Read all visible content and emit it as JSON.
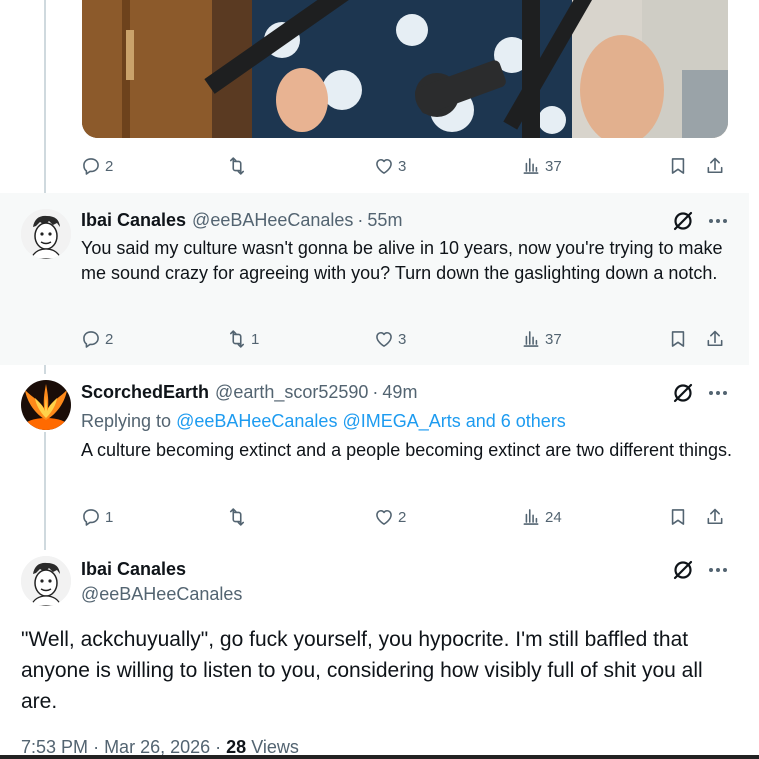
{
  "media_tweet": {
    "actions": {
      "replies": "2",
      "reposts": "",
      "likes": "3",
      "views": "37"
    }
  },
  "tweets": [
    {
      "name": "Ibai Canales",
      "handle": "@eeBAHeeCanales",
      "time": "55m",
      "text": "You said my culture wasn't gonna be alive in 10 years, now you're trying to make me sound crazy for agreeing with you? Turn down the gaslighting down a notch.",
      "actions": {
        "replies": "2",
        "reposts": "1",
        "likes": "3",
        "views": "37"
      }
    },
    {
      "name": "ScorchedEarth",
      "handle": "@earth_scor52590",
      "time": "49m",
      "replying_label": "Replying to",
      "replying_users": "@eeBAHeeCanales @IMEGA_Arts and 6 others",
      "text": "A culture becoming extinct and a people becoming extinct are two different things.",
      "actions": {
        "replies": "1",
        "reposts": "",
        "likes": "2",
        "views": "24"
      }
    }
  ],
  "focus_tweet": {
    "name": "Ibai Canales",
    "handle": "@eeBAHeeCanales",
    "text": "\"Well, ackchuyually\", go fuck yourself, you hypocrite. I'm still baffled that anyone is willing to listen to you, considering how visibly full of shit you all are.",
    "time": "7:53 PM",
    "date": "Mar 26, 2026",
    "views_count": "28",
    "views_label": "Views"
  },
  "colors": {
    "accent": "#1d9bf0",
    "muted": "#536471",
    "highlight_bg": "#f7f9f9"
  },
  "icons": [
    "reply-icon",
    "repost-icon",
    "like-icon",
    "views-icon",
    "bookmark-icon",
    "share-icon",
    "grok-icon",
    "more-icon"
  ]
}
